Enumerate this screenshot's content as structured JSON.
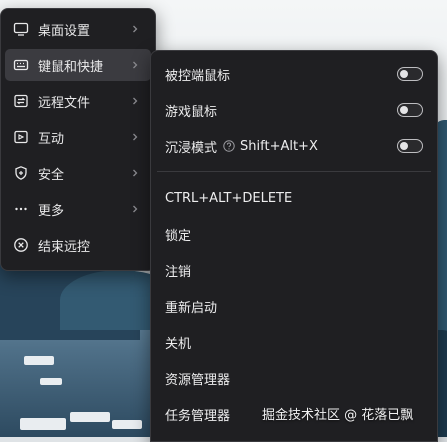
{
  "main_menu": {
    "items": [
      {
        "label": "桌面设置",
        "icon": "monitor-icon",
        "has_submenu": true
      },
      {
        "label": "键鼠和快捷",
        "icon": "keyboard-icon",
        "has_submenu": true
      },
      {
        "label": "远程文件",
        "icon": "file-transfer-icon",
        "has_submenu": true
      },
      {
        "label": "互动",
        "icon": "interaction-icon",
        "has_submenu": true
      },
      {
        "label": "安全",
        "icon": "shield-icon",
        "has_submenu": true
      },
      {
        "label": "更多",
        "icon": "more-icon",
        "has_submenu": true
      },
      {
        "label": "结束远控",
        "icon": "close-circle-icon",
        "has_submenu": false
      }
    ],
    "active_index": 1
  },
  "sub_menu": {
    "toggles": [
      {
        "label": "被控端鼠标",
        "on": false
      },
      {
        "label": "游戏鼠标",
        "on": false
      },
      {
        "label": "沉浸模式",
        "shortcut": "Shift+Alt+X",
        "on": false,
        "help_icon": "help-icon"
      }
    ],
    "actions": [
      {
        "label": "CTRL+ALT+DELETE"
      },
      {
        "label": "锁定"
      },
      {
        "label": "注销"
      },
      {
        "label": "重新启动"
      },
      {
        "label": "关机"
      },
      {
        "label": "资源管理器"
      },
      {
        "label": "任务管理器"
      }
    ]
  },
  "watermark": "掘金技术社区 @ 花落已飘",
  "colors": {
    "menu_bg": "#1f1f22",
    "active_bg": "#3b3b40",
    "text": "#e9e9ea"
  }
}
